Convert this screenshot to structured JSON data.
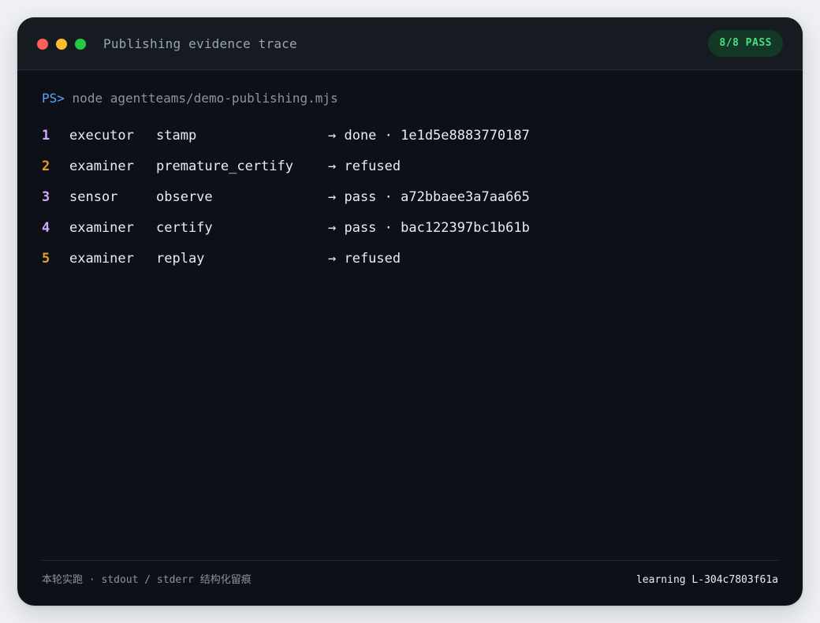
{
  "window": {
    "title": "Publishing evidence trace",
    "badge": "8/8 PASS"
  },
  "terminal": {
    "prompt": "PS>",
    "command": "node agentteams/demo-publishing.mjs",
    "rows": [
      {
        "num": "1",
        "role": "executor",
        "step": "stamp",
        "result": "→ done · 1e1d5e8883770187"
      },
      {
        "num": "2",
        "role": "examiner",
        "step": "premature_certify",
        "result": "→ refused"
      },
      {
        "num": "3",
        "role": "sensor",
        "step": "observe",
        "result": "→ pass · a72bbaee3a7aa665"
      },
      {
        "num": "4",
        "role": "examiner",
        "step": "certify",
        "result": "→ pass · bac122397bc1b61b"
      },
      {
        "num": "5",
        "role": "examiner",
        "step": "replay",
        "result": "→ refused"
      }
    ]
  },
  "footer": {
    "left": "本轮实跑 · stdout / stderr 结构化留痕",
    "right": "learning L-304c7803f61a"
  },
  "colors": {
    "background": "#0d1117",
    "titlebar": "#161b22",
    "accent_prompt": "#58a6ff",
    "pass_badge": "#4ade80",
    "row_num_pass": "#d2a8ff",
    "row_num_refused": "#e3a02f"
  }
}
